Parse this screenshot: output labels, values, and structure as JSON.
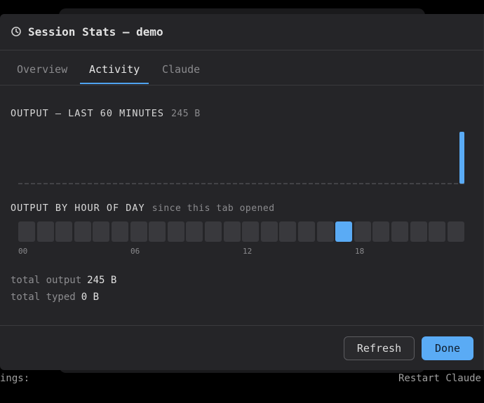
{
  "dialog": {
    "title": "Session Stats — demo"
  },
  "tabs": [
    {
      "label": "Overview",
      "active": false
    },
    {
      "label": "Activity",
      "active": true
    },
    {
      "label": "Claude",
      "active": false
    }
  ],
  "output_timeline": {
    "title": "OUTPUT — LAST 60 MINUTES",
    "total": "245 B",
    "accent_color": "#5aabf5",
    "minute_values": [
      0,
      0,
      0,
      0,
      0,
      0,
      0,
      0,
      0,
      0,
      0,
      0,
      0,
      0,
      0,
      0,
      0,
      0,
      0,
      0,
      0,
      0,
      0,
      0,
      0,
      0,
      0,
      0,
      0,
      0,
      0,
      0,
      0,
      0,
      0,
      0,
      0,
      0,
      0,
      0,
      0,
      0,
      0,
      0,
      0,
      0,
      0,
      0,
      0,
      0,
      0,
      0,
      0,
      0,
      0,
      0,
      0,
      0,
      0,
      245
    ]
  },
  "hourly": {
    "title": "OUTPUT BY HOUR OF DAY",
    "subtitle": "since this tab opened",
    "hours": [
      0,
      0,
      0,
      0,
      0,
      0,
      0,
      0,
      0,
      0,
      0,
      0,
      0,
      0,
      0,
      0,
      0,
      245,
      0,
      0,
      0,
      0,
      0,
      0
    ],
    "labels": [
      "00",
      "06",
      "12",
      "18"
    ]
  },
  "stats": {
    "total_output_label": "total output",
    "total_output_value": "245 B",
    "total_typed_label": "total typed",
    "total_typed_value": "0 B"
  },
  "footer": {
    "refresh_label": "Refresh",
    "done_label": "Done"
  },
  "background": {
    "status_left": "ings: ",
    "status_right": "Restart Claude"
  }
}
